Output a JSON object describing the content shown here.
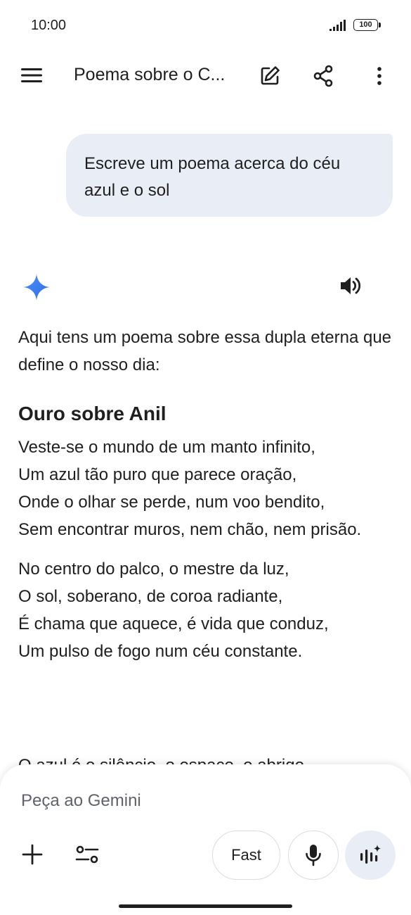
{
  "status_bar": {
    "time": "10:00",
    "battery": "100"
  },
  "top_bar": {
    "title": "Poema sobre o C..."
  },
  "user_message": {
    "text": "Escreve um poema acerca do céu azul e o sol"
  },
  "response": {
    "intro": "Aqui tens um poema sobre essa dupla eterna que define o nosso dia:",
    "poem_title": "Ouro sobre Anil",
    "stanza_1": [
      "Veste-se o mundo de um manto infinito,",
      "Um azul tão puro que parece oração,",
      "Onde o olhar se perde, num voo bendito,",
      "Sem encontrar muros, nem chão, nem prisão."
    ],
    "stanza_2": [
      "No centro do palco, o mestre da luz,",
      "O sol, soberano, de coroa radiante,",
      "É chama que aquece, é vida que conduz,",
      "Um pulso de fogo num céu constante."
    ],
    "partial_line": "O azul é o silêncio, o espaço, o abrigo,"
  },
  "input": {
    "placeholder": "Peça ao Gemini",
    "mode_label": "Fast"
  },
  "colors": {
    "accent": "#4285f4",
    "bubble": "#e9eef6",
    "text": "#1f1f1f"
  }
}
